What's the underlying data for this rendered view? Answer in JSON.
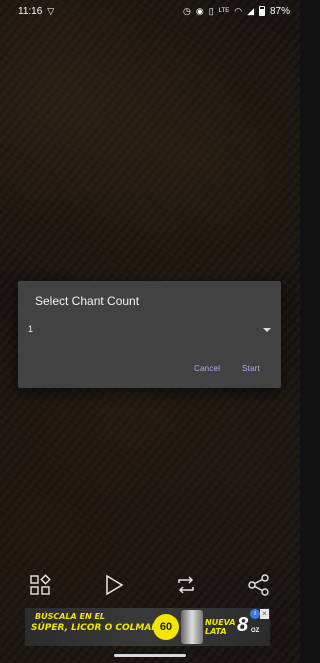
{
  "status_bar": {
    "time": "11:16",
    "network": "LTE",
    "battery": "87%"
  },
  "dialog": {
    "title": "Select Chant Count",
    "select_value": "1",
    "cancel_label": "Cancel",
    "start_label": "Start"
  },
  "toolbar": {
    "items": [
      "grid-shapes-icon",
      "play-icon",
      "repeat-icon",
      "share-icon"
    ]
  },
  "ad": {
    "line1": "BÚSCALA EN EL",
    "line2": "SÚPER, LICOR O COLMADO.",
    "badge": "60",
    "new_line1": "NUEVA",
    "new_line2": "LATA",
    "size_number": "8",
    "size_unit": "OZ",
    "info_label": "i",
    "close_label": "×"
  }
}
